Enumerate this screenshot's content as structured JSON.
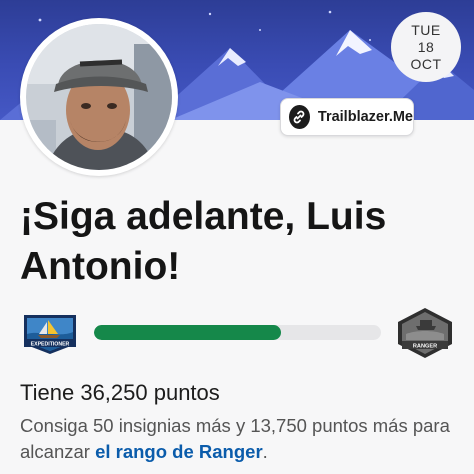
{
  "date": {
    "weekday": "TUE",
    "day": "18",
    "month": "OCT"
  },
  "trailblazer_button": {
    "label": "Trailblazer.Me"
  },
  "headline": "¡Siga adelante, Luis Antonio!",
  "rank": {
    "current_label": "EXPEDITIONER",
    "next_label": "RANGER",
    "progress_percent": 65
  },
  "points_text": "Tiene 36,250 puntos",
  "goal": {
    "text_before": "Consiga 50 insignias más y 13,750 puntos más para alcanzar ",
    "link_text": "el rango de Ranger",
    "text_after": "."
  },
  "colors": {
    "banner": "#3a4cb4",
    "progress": "#15884a",
    "link": "#0b5cab"
  },
  "icons": {
    "profile": "avatar-photo",
    "button": "link-icon",
    "current_rank": "expeditioner-badge-icon",
    "next_rank": "ranger-badge-icon"
  }
}
